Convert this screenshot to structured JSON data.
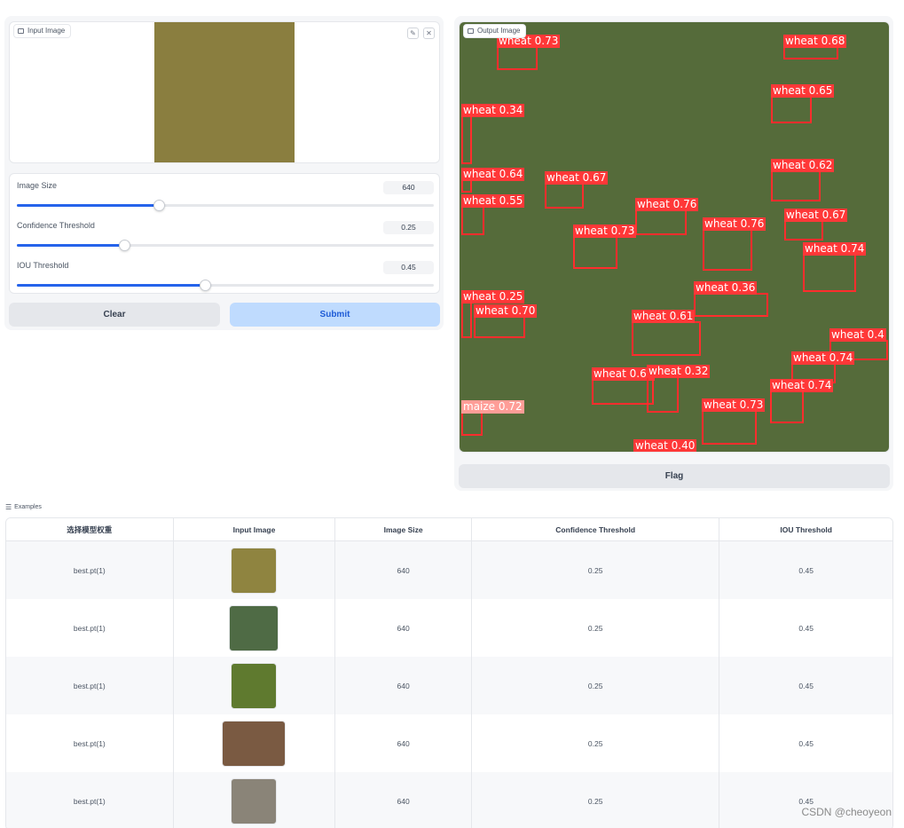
{
  "input": {
    "label": "Input Image",
    "tools": {
      "edit_icon": "pencil-icon",
      "close_icon": "close-icon"
    },
    "photo_color": "#8a7e3f"
  },
  "settings": {
    "image_size": {
      "label": "Image Size",
      "value": "640",
      "fraction": 0.34
    },
    "confidence": {
      "label": "Confidence Threshold",
      "value": "0.25",
      "fraction": 0.258
    },
    "iou": {
      "label": "IOU Threshold",
      "value": "0.45",
      "fraction": 0.451
    }
  },
  "buttons": {
    "clear": "Clear",
    "submit": "Submit",
    "flag": "Flag"
  },
  "output": {
    "label": "Output Image",
    "photo_color": "#556b3a",
    "detections": [
      {
        "label": "wheat 0.73",
        "cls": "wheat"
      },
      {
        "label": "wheat 0.68",
        "cls": "wheat"
      },
      {
        "label": "wheat 0.34",
        "cls": "wheat"
      },
      {
        "label": "wheat 0.65",
        "cls": "wheat"
      },
      {
        "label": "wheat 0.64",
        "cls": "wheat"
      },
      {
        "label": "wheat 0.67",
        "cls": "wheat"
      },
      {
        "label": "wheat 0.62",
        "cls": "wheat"
      },
      {
        "label": "wheat 0.55",
        "cls": "wheat"
      },
      {
        "label": "wheat 0.76",
        "cls": "wheat"
      },
      {
        "label": "wheat 0.67",
        "cls": "wheat"
      },
      {
        "label": "wheat 0.73",
        "cls": "wheat"
      },
      {
        "label": "wheat 0.76",
        "cls": "wheat"
      },
      {
        "label": "wheat 0.74",
        "cls": "wheat"
      },
      {
        "label": "wheat 0.36",
        "cls": "wheat"
      },
      {
        "label": "wheat 0.25",
        "cls": "wheat"
      },
      {
        "label": "wheat 0.70",
        "cls": "wheat"
      },
      {
        "label": "wheat 0.61",
        "cls": "wheat"
      },
      {
        "label": "wheat 0.4",
        "cls": "wheat"
      },
      {
        "label": "wheat 0.74",
        "cls": "wheat"
      },
      {
        "label": "wheat 0.64",
        "cls": "wheat"
      },
      {
        "label": "wheat 0.32",
        "cls": "wheat"
      },
      {
        "label": "wheat 0.74",
        "cls": "wheat"
      },
      {
        "label": "maize 0.72",
        "cls": "maize"
      },
      {
        "label": "wheat 0.73",
        "cls": "wheat"
      },
      {
        "label": "wheat 0.40",
        "cls": "wheat"
      }
    ]
  },
  "examples": {
    "header": "Examples",
    "columns": [
      "选择模型权重",
      "Input Image",
      "Image Size",
      "Confidence Threshold",
      "IOU Threshold"
    ],
    "rows": [
      {
        "model": "best.pt(1)",
        "thumb_color": "#8f8440",
        "size": "640",
        "conf": "0.25",
        "iou": "0.45"
      },
      {
        "model": "best.pt(1)",
        "thumb_color": "#4f6b45",
        "size": "640",
        "conf": "0.25",
        "iou": "0.45"
      },
      {
        "model": "best.pt(1)",
        "thumb_color": "#5f7a2f",
        "size": "640",
        "conf": "0.25",
        "iou": "0.45"
      },
      {
        "model": "best.pt(1)",
        "thumb_color": "#7a5a42",
        "size": "640",
        "conf": "0.25",
        "iou": "0.45"
      },
      {
        "model": "best.pt(1)",
        "thumb_color": "#8a8478",
        "size": "640",
        "conf": "0.25",
        "iou": "0.45"
      }
    ]
  },
  "watermark": "CSDN @cheoyeon"
}
